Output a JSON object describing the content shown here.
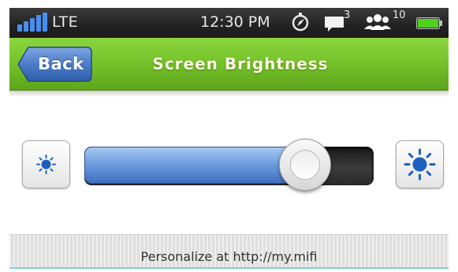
{
  "status_bar": {
    "network": "LTE",
    "time": "12:30 PM",
    "messages_count": "3",
    "users_count": "10",
    "icons": [
      "signal-bars-icon",
      "compass-icon",
      "message-icon",
      "users-icon",
      "battery-icon"
    ],
    "signal_color": "#4a8ff0",
    "battery_color": "#4cd21c"
  },
  "header": {
    "back_label": "Back",
    "title": "Screen Brightness",
    "bar_color": "#74c229"
  },
  "brightness": {
    "level": 0.76,
    "dim_icon": "sun-small-icon",
    "bright_icon": "sun-large-icon",
    "fill_color": "#6f9fe0"
  },
  "footer": {
    "text": "Personalize at http://my.mifi"
  }
}
